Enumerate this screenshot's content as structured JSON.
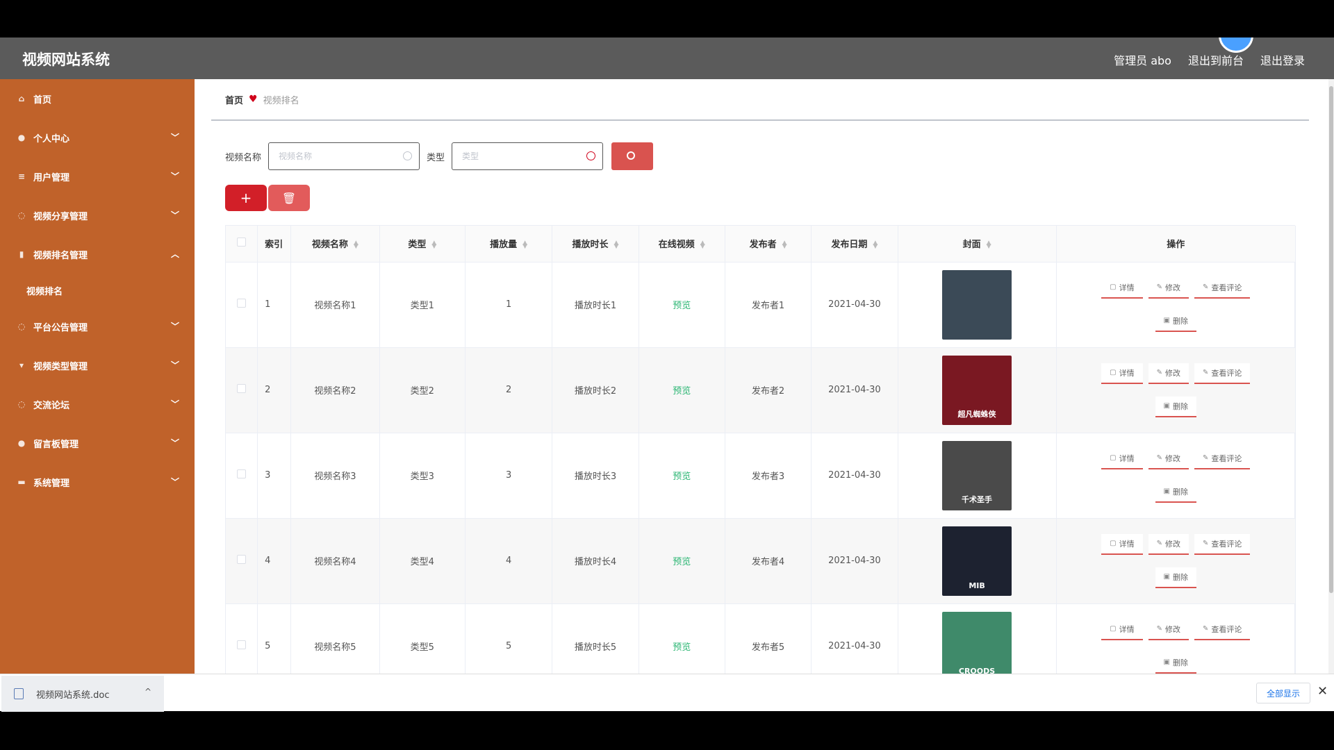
{
  "header": {
    "app_title": "视频网站系统",
    "admin_label": "管理员 abo",
    "front_link": "退出到前台",
    "logout_link": "退出登录"
  },
  "sidebar": {
    "items": [
      {
        "label": "首页",
        "icon": "home-icon",
        "expanded": false,
        "has_chevron": false
      },
      {
        "label": "个人中心",
        "icon": "user-icon",
        "has_chevron": true
      },
      {
        "label": "用户管理",
        "icon": "list-icon",
        "has_chevron": true
      },
      {
        "label": "视频分享管理",
        "icon": "share-icon",
        "has_chevron": true
      },
      {
        "label": "视频排名管理",
        "icon": "chart-icon",
        "has_chevron": true,
        "expanded": true
      },
      {
        "label": "视频排名",
        "sub": true
      },
      {
        "label": "平台公告管理",
        "icon": "notice-icon",
        "has_chevron": true
      },
      {
        "label": "视频类型管理",
        "icon": "tag-icon",
        "has_chevron": true
      },
      {
        "label": "交流论坛",
        "icon": "forum-icon",
        "has_chevron": true
      },
      {
        "label": "留言板管理",
        "icon": "message-icon",
        "has_chevron": true
      },
      {
        "label": "系统管理",
        "icon": "settings-icon",
        "has_chevron": true
      }
    ]
  },
  "breadcrumb": {
    "home": "首页",
    "current": "视频排名"
  },
  "search": {
    "name_label": "视频名称",
    "name_placeholder": "视频名称",
    "type_label": "类型",
    "type_placeholder": "类型"
  },
  "table": {
    "headers": [
      "索引",
      "视频名称",
      "类型",
      "播放量",
      "播放时长",
      "在线视频",
      "发布者",
      "发布日期",
      "封面",
      "操作"
    ],
    "rows": [
      {
        "index": "1",
        "name": "视频名称1",
        "type": "类型1",
        "plays": "1",
        "duration": "播放时长1",
        "online": "预览",
        "publisher": "发布者1",
        "date": "2021-04-30",
        "cover_color": "#3b4a57",
        "cover_caption": ""
      },
      {
        "index": "2",
        "name": "视频名称2",
        "type": "类型2",
        "plays": "2",
        "duration": "播放时长2",
        "online": "预览",
        "publisher": "发布者2",
        "date": "2021-04-30",
        "cover_color": "#7a1822",
        "cover_caption": "超凡蜘蛛侠"
      },
      {
        "index": "3",
        "name": "视频名称3",
        "type": "类型3",
        "plays": "3",
        "duration": "播放时长3",
        "online": "预览",
        "publisher": "发布者3",
        "date": "2021-04-30",
        "cover_color": "#4a4a4a",
        "cover_caption": "千术圣手"
      },
      {
        "index": "4",
        "name": "视频名称4",
        "type": "类型4",
        "plays": "4",
        "duration": "播放时长4",
        "online": "预览",
        "publisher": "发布者4",
        "date": "2021-04-30",
        "cover_color": "#1d2230",
        "cover_caption": "MIB"
      },
      {
        "index": "5",
        "name": "视频名称5",
        "type": "类型5",
        "plays": "5",
        "duration": "播放时长5",
        "online": "预览",
        "publisher": "发布者5",
        "date": "2021-04-30",
        "cover_color": "#3f8a6a",
        "cover_caption": "CROODS"
      }
    ],
    "ops": {
      "detail": "详情",
      "edit": "修改",
      "comments": "查看评论",
      "delete": "删除"
    }
  },
  "download_bar": {
    "file_name": "视频网站系统.doc",
    "show_all": "全部显示"
  }
}
